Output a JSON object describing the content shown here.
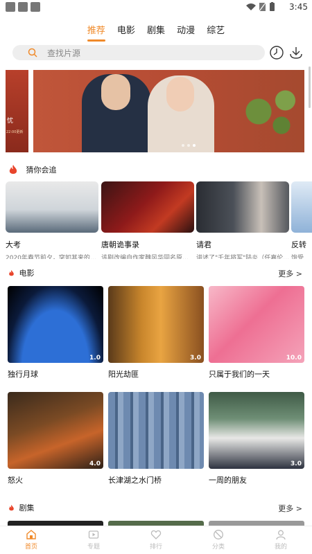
{
  "status": {
    "time": "3:45"
  },
  "tabs": [
    {
      "label": "推荐",
      "active": true
    },
    {
      "label": "电影",
      "active": false
    },
    {
      "label": "剧集",
      "active": false
    },
    {
      "label": "动漫",
      "active": false
    },
    {
      "label": "综艺",
      "active": false
    }
  ],
  "search": {
    "placeholder": "查找片源"
  },
  "header_icons": [
    "history-icon",
    "download-icon"
  ],
  "banner": {
    "dots": 3,
    "active_dot": 2,
    "left_slice_text": "忧",
    "left_slice_sub": "22:00更新"
  },
  "guess": {
    "title": "猜你会追",
    "items": [
      {
        "title": "大考",
        "desc": "2020年春节前夕，突如其来的…"
      },
      {
        "title": "唐朝诡事录",
        "desc": "该剧改编自作家魏风华同名原…"
      },
      {
        "title": "请君",
        "desc": "讲述了\"千年将军\"陆炎（任嘉伦…"
      },
      {
        "title": "反转",
        "desc": "饱受"
      }
    ]
  },
  "movies": {
    "title": "电影",
    "more": "更多 >",
    "items": [
      {
        "title": "独行月球",
        "score": "1.0"
      },
      {
        "title": "阳光劫匪",
        "score": "3.0"
      },
      {
        "title": "只属于我们的一天",
        "score": "10.0"
      },
      {
        "title": "怒火",
        "score": "4.0"
      },
      {
        "title": "长津湖之水门桥",
        "score": ""
      },
      {
        "title": "一周的朋友",
        "score": "3.0"
      }
    ]
  },
  "series": {
    "title": "剧集",
    "more": "更多 >"
  },
  "nav": [
    {
      "label": "首页",
      "icon": "home-icon",
      "active": true
    },
    {
      "label": "专题",
      "icon": "play-icon",
      "active": false
    },
    {
      "label": "排行",
      "icon": "heart-icon",
      "active": false
    },
    {
      "label": "分类",
      "icon": "category-icon",
      "active": false
    },
    {
      "label": "我的",
      "icon": "user-icon",
      "active": false
    }
  ],
  "colors": {
    "accent": "#f08a2a",
    "flame": "#e8452c"
  }
}
